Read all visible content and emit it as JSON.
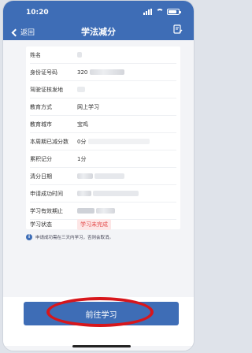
{
  "status": {
    "time": "10:20"
  },
  "nav": {
    "back_label": "返回",
    "title": "学法减分"
  },
  "rows": [
    {
      "label": "姓名",
      "value": ""
    },
    {
      "label": "身份证号码",
      "value": "320"
    },
    {
      "label": "驾驶证核发地",
      "value": ""
    },
    {
      "label": "教育方式",
      "value": "网上学习"
    },
    {
      "label": "教育城市",
      "value": "宝鸡"
    },
    {
      "label": "本周期已减分数",
      "value": "0分"
    },
    {
      "label": "累积记分",
      "value": "1分"
    },
    {
      "label": "清分日期",
      "value": ""
    },
    {
      "label": "申请成功时间",
      "value": ""
    },
    {
      "label": "学习有效期止",
      "value": ""
    },
    {
      "label": "学习状态",
      "value": "学习未完成"
    }
  ],
  "notice": {
    "text": "申请成功需在三天内学习，否则会取消。"
  },
  "action": {
    "label": "前往学习"
  },
  "colors": {
    "primary": "#3e6db6",
    "status_red": "#e34b4b",
    "highlight": "#d7161b"
  }
}
